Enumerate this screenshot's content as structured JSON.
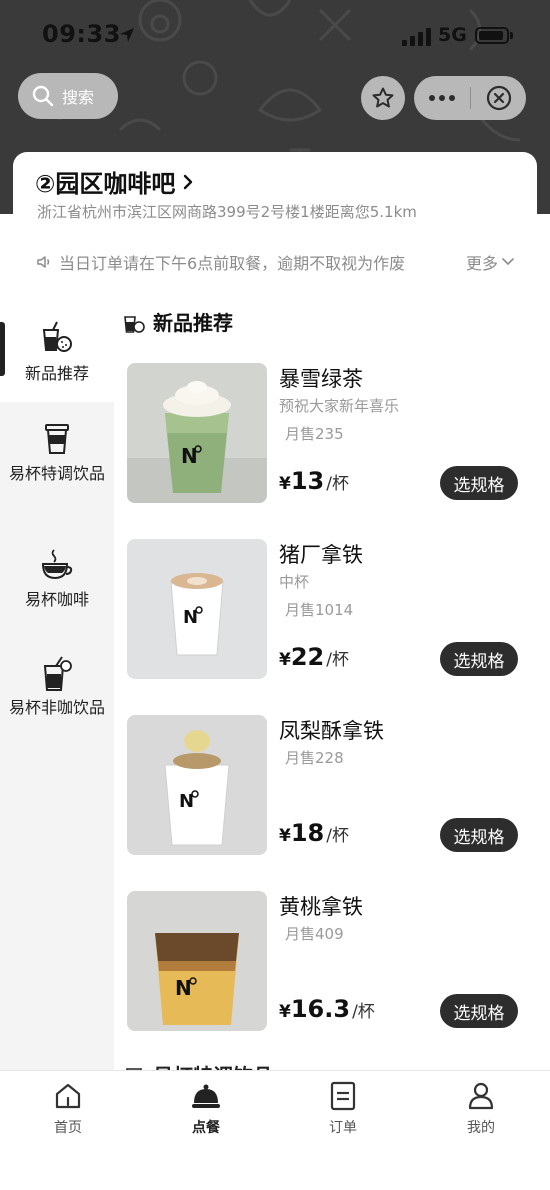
{
  "status_bar": {
    "time": "09:33",
    "network": "5G"
  },
  "nav": {
    "search_label": "搜索"
  },
  "store": {
    "name": "②园区咖啡吧",
    "address": "浙江省杭州市滨江区网商路399号2号楼1楼距离您5.1km",
    "notice": "当日订单请在下午6点前取餐，逾期不取视为作废",
    "more_label": "更多"
  },
  "sidebar": {
    "items": [
      {
        "label": "新品推荐",
        "icon": "new-drinks-icon",
        "active": true
      },
      {
        "label": "易杯特调饮品",
        "icon": "cup-icon",
        "active": false
      },
      {
        "label": "易杯咖啡",
        "icon": "coffee-cup-icon",
        "active": false
      },
      {
        "label": "易杯非咖饮品",
        "icon": "juice-icon",
        "active": false
      }
    ]
  },
  "menu": {
    "section_title": "新品推荐",
    "next_section_title": "易杯特调饮品",
    "spec_button_label": "选规格",
    "currency": "¥",
    "unit": "/杯",
    "products": [
      {
        "name": "暴雪绿茶",
        "desc": "预祝大家新年喜乐",
        "sold": "月售235",
        "price": "13"
      },
      {
        "name": "猪厂拿铁",
        "desc": "中杯",
        "sold": "月售1014",
        "price": "22"
      },
      {
        "name": "凤梨酥拿铁",
        "desc": "",
        "sold": "月售228",
        "price": "18"
      },
      {
        "name": "黄桃拿铁",
        "desc": "",
        "sold": "月售409",
        "price": "16.3"
      }
    ]
  },
  "tabbar": {
    "tabs": [
      {
        "label": "首页",
        "icon": "home-icon",
        "active": false
      },
      {
        "label": "点餐",
        "icon": "cloche-icon",
        "active": true
      },
      {
        "label": "订单",
        "icon": "order-list-icon",
        "active": false
      },
      {
        "label": "我的",
        "icon": "profile-icon",
        "active": false
      }
    ]
  },
  "colors": {
    "header_bg": "#3a3a3a",
    "button_dark": "#2d2d2d",
    "sidebar_bg": "#f4f4f4",
    "muted_text": "#9a9a9a"
  }
}
